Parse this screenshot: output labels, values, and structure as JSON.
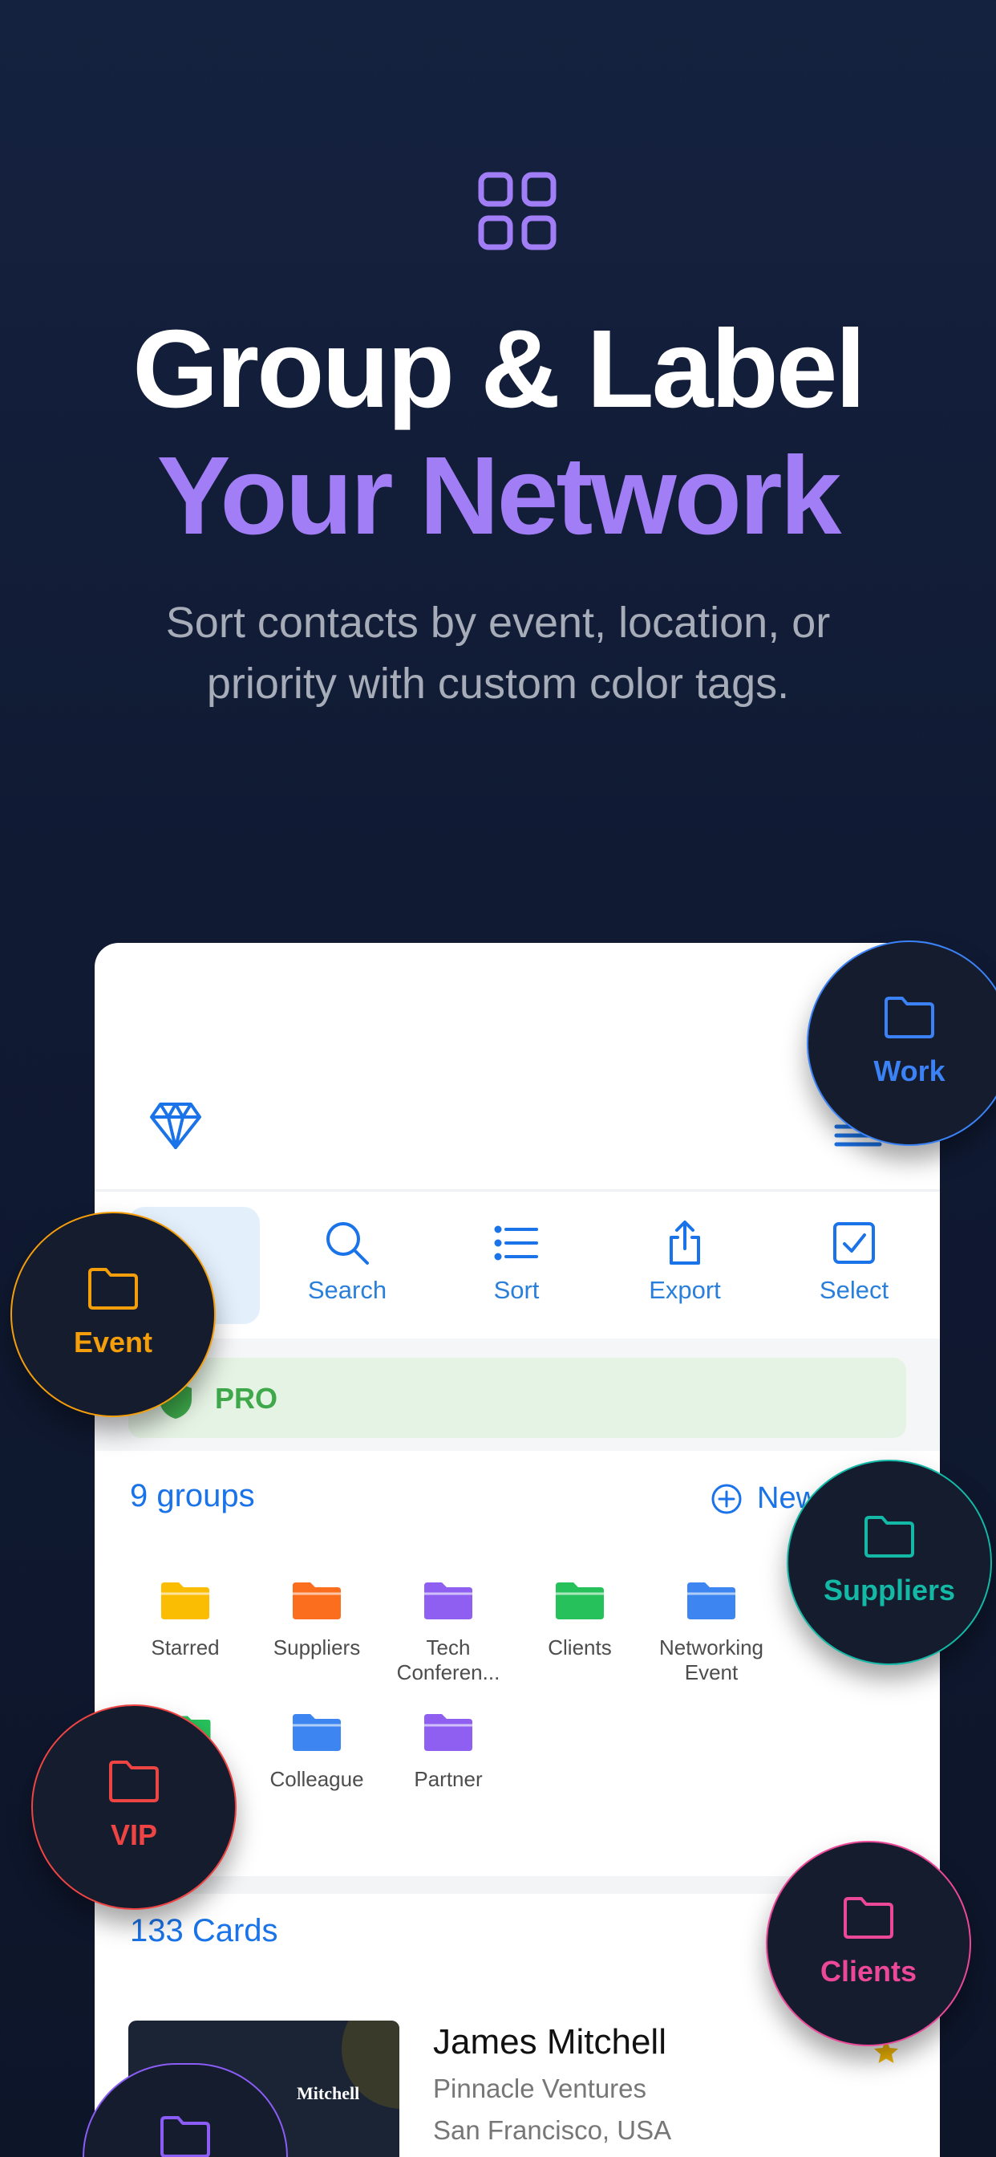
{
  "hero": {
    "icon": "grid-icon",
    "title_line1": "Group & Label",
    "title_line2": "Your Network",
    "subtitle_line1": "Sort contacts by event, location, or",
    "subtitle_line2": "priority with custom color tags."
  },
  "app": {
    "header_icon": "diamond-icon",
    "menu_icon": "hamburger-icon",
    "toolbar": [
      {
        "label": "Search",
        "icon": "search-icon"
      },
      {
        "label": "Sort",
        "icon": "list-icon"
      },
      {
        "label": "Export",
        "icon": "share-icon"
      },
      {
        "label": "Select",
        "icon": "checkbox-icon"
      }
    ],
    "pro_label": "PRO",
    "groups": {
      "count_label": "9 groups",
      "new_label": "New",
      "items": [
        {
          "label": "Starred",
          "color": "#fbbc04"
        },
        {
          "label": "Suppliers",
          "color": "#fa6e1e"
        },
        {
          "label": "Tech Conferen...",
          "color": "#8e5ff0"
        },
        {
          "label": "Clients",
          "color": "#27c15c"
        },
        {
          "label": "Networking Event",
          "color": "#3d86f2"
        },
        {
          "label": "Colleague",
          "color": "#3d86f2"
        },
        {
          "label": "Partner",
          "color": "#8e5ff0"
        }
      ]
    },
    "cards": {
      "count_label": "133 Cards",
      "items": [
        {
          "name": "James Mitchell",
          "company": "Pinnacle Ventures",
          "location": "San Francisco, USA",
          "card_name": "Mitchell"
        }
      ]
    }
  },
  "tags": [
    {
      "label": "Work",
      "color": "#3b82f6"
    },
    {
      "label": "Event",
      "color": "#f59e0b"
    },
    {
      "label": "Suppliers",
      "color": "#14b8a6"
    },
    {
      "label": "VIP",
      "color": "#ef4444"
    },
    {
      "label": "Clients",
      "color": "#ec4899"
    },
    {
      "label": "",
      "color": "#8b5cf6"
    }
  ]
}
